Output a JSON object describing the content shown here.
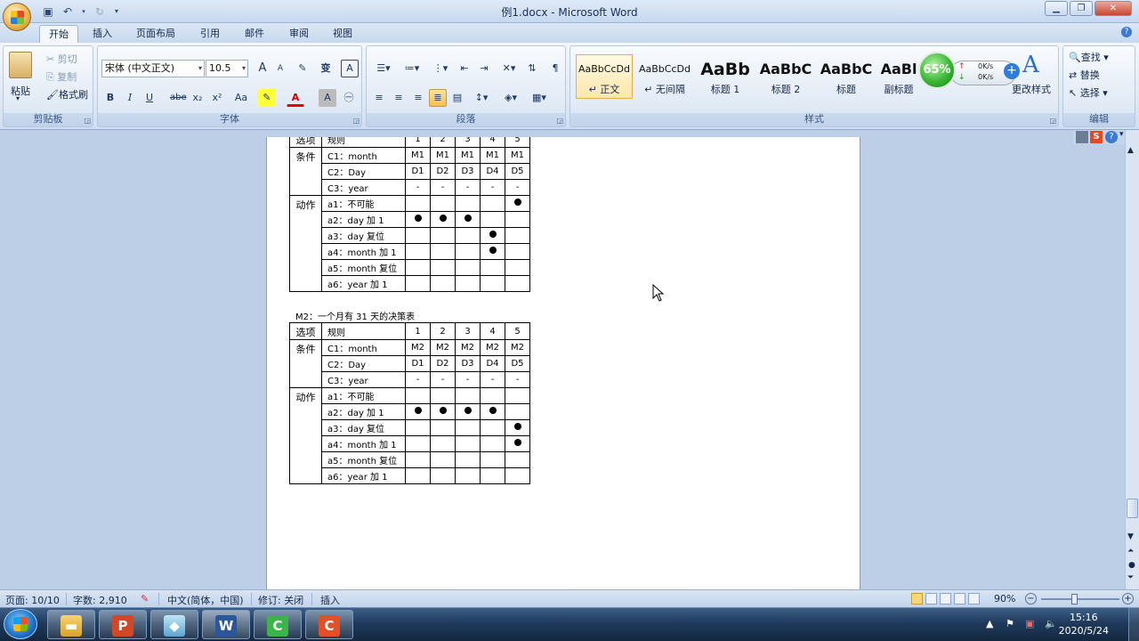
{
  "window": {
    "title": "例1.docx - Microsoft Word"
  },
  "tabs": [
    "开始",
    "插入",
    "页面布局",
    "引用",
    "邮件",
    "审阅",
    "视图"
  ],
  "clipboard": {
    "paste": "粘贴",
    "cut": "剪切",
    "copy": "复制",
    "format_painter": "格式刷",
    "label": "剪贴板"
  },
  "font": {
    "name": "宋体 (中文正文)",
    "size": "10.5",
    "label": "字体",
    "bold": "B",
    "italic": "I",
    "underline": "U",
    "strike": "abe",
    "sub": "x₂",
    "sup": "x²",
    "case": "Aa",
    "grow": "A",
    "shrink": "A",
    "clear": "✎",
    "phonetic": "变",
    "border_char": "A"
  },
  "paragraph": {
    "label": "段落"
  },
  "styles": {
    "label": "样式",
    "items": [
      {
        "preview": "AaBbCcDd",
        "name": "↵ 正文"
      },
      {
        "preview": "AaBbCcDd",
        "name": "↵ 无间隔"
      },
      {
        "preview": "AaBb",
        "name": "标题 1"
      },
      {
        "preview": "AaBbC",
        "name": "标题 2"
      },
      {
        "preview": "AaBbC",
        "name": "标题"
      },
      {
        "preview": "AaBl",
        "name": "副标题"
      }
    ],
    "change": "更改样式"
  },
  "editing": {
    "find": "查找",
    "replace": "替换",
    "select": "选择",
    "label": "编辑"
  },
  "speed_widget": {
    "percent": "65%",
    "up": "0K/s",
    "down": "0K/s"
  },
  "table1": {
    "header": [
      "选项",
      "规则",
      "1",
      "2",
      "3",
      "4",
      "5"
    ],
    "cond_label": "条件",
    "conditions": [
      {
        "label": "C1：month",
        "cells": [
          "M1",
          "M1",
          "M1",
          "M1",
          "M1"
        ]
      },
      {
        "label": "C2：Day",
        "cells": [
          "D1",
          "D2",
          "D3",
          "D4",
          "D5"
        ]
      },
      {
        "label": "C3：year",
        "cells": [
          "-",
          "-",
          "-",
          "-",
          "-"
        ]
      }
    ],
    "action_label": "动作",
    "actions": [
      {
        "label": "a1：不可能",
        "marks": [
          false,
          false,
          false,
          false,
          true
        ]
      },
      {
        "label": "a2：day 加 1",
        "marks": [
          true,
          true,
          true,
          false,
          false
        ]
      },
      {
        "label": "a3：day 复位",
        "marks": [
          false,
          false,
          false,
          true,
          false
        ]
      },
      {
        "label": "a4：month 加 1",
        "marks": [
          false,
          false,
          false,
          true,
          false
        ]
      },
      {
        "label": "a5：month 复位",
        "marks": [
          false,
          false,
          false,
          false,
          false
        ]
      },
      {
        "label": "a6：year 加 1",
        "marks": [
          false,
          false,
          false,
          false,
          false
        ]
      }
    ]
  },
  "caption2": "M2：一个月有 31 天的决策表",
  "table2": {
    "header": [
      "选项",
      "规则",
      "1",
      "2",
      "3",
      "4",
      "5"
    ],
    "cond_label": "条件",
    "conditions": [
      {
        "label": "C1：month",
        "cells": [
          "M2",
          "M2",
          "M2",
          "M2",
          "M2"
        ]
      },
      {
        "label": "C2：Day",
        "cells": [
          "D1",
          "D2",
          "D3",
          "D4",
          "D5"
        ]
      },
      {
        "label": "C3：year",
        "cells": [
          "-",
          "-",
          "-",
          "-",
          "-"
        ]
      }
    ],
    "action_label": "动作",
    "actions": [
      {
        "label": "a1：不可能",
        "marks": [
          false,
          false,
          false,
          false,
          false
        ]
      },
      {
        "label": "a2：day 加 1",
        "marks": [
          true,
          true,
          true,
          true,
          false
        ]
      },
      {
        "label": "a3：day 复位",
        "marks": [
          false,
          false,
          false,
          false,
          true
        ]
      },
      {
        "label": "a4：month 加 1",
        "marks": [
          false,
          false,
          false,
          false,
          true
        ]
      },
      {
        "label": "a5：month 复位",
        "marks": [
          false,
          false,
          false,
          false,
          false
        ]
      },
      {
        "label": "a6：year 加 1",
        "marks": [
          false,
          false,
          false,
          false,
          false
        ]
      }
    ]
  },
  "status": {
    "page": "页面: 10/10",
    "words": "字数: 2,910",
    "lang": "中文(简体，中国)",
    "revisions": "修订: 关闭",
    "insert": "插入",
    "zoom": "90%"
  },
  "clock": {
    "time": "15:16",
    "date": "2020/5/24"
  }
}
